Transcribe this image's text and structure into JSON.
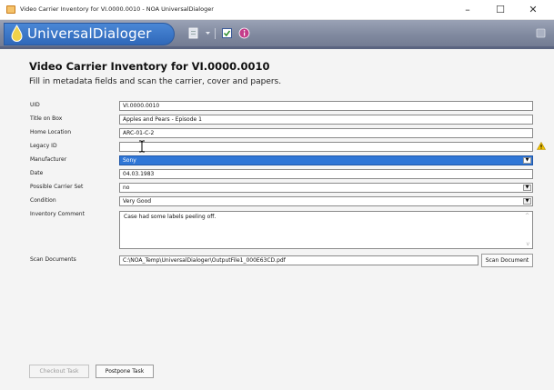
{
  "window": {
    "title": "Video Carrier Inventory for VI.0000.0010 - NOA UniversalDialoger",
    "minimize": "–",
    "maximize": "☐",
    "close": "✕"
  },
  "ribbon": {
    "app_name": "UniversalDialoger",
    "icons": [
      "document-icon",
      "dropdown-arrow-icon",
      "checkbox-icon",
      "info-icon",
      "settings-icon"
    ]
  },
  "form": {
    "heading": "Video Carrier Inventory for VI.0000.0010",
    "subheading": "Fill in metadata fields and scan the carrier, cover and papers.",
    "fields": [
      {
        "label": "UID",
        "value": "VI.0000.0010"
      },
      {
        "label": "Title on Box",
        "value": "Apples and Pears - Episode 1"
      },
      {
        "label": "Home Location",
        "value": "ARC-01-C-2"
      },
      {
        "label": "Legacy ID",
        "value": ""
      },
      {
        "label": "Manufacturer",
        "value": "Sony"
      },
      {
        "label": "Date",
        "value": "04.03.1983"
      },
      {
        "label": "Possible Carrier Set",
        "value": "no"
      },
      {
        "label": "Condition",
        "value": "Very Good"
      },
      {
        "label": "Inventory Comment",
        "value": "Case had some labels peeling off."
      },
      {
        "label": "Scan Documents",
        "value": "C:\\NOA_Temp\\UniversalDialoger\\OutputFile1_000E63CD.pdf"
      }
    ],
    "scan_button": "Scan Document"
  },
  "footer": {
    "checkout_task": "Checkout Task",
    "postpone_task": "Postpone Task"
  },
  "colors": {
    "selection": "#2f76d6",
    "ribbon": "#7f889e",
    "logo": "#3a76c8",
    "warning": "#f2c300"
  }
}
